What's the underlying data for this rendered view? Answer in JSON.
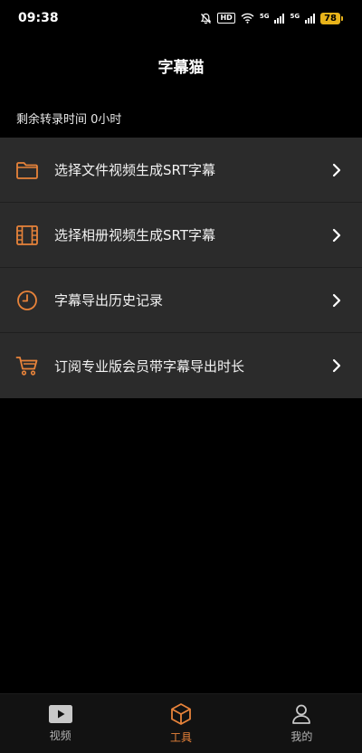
{
  "status_bar": {
    "time": "09:38",
    "hd_label": "HD",
    "net1_label": "5G",
    "net2_label": "5G",
    "battery": "78",
    "icons": [
      "mute-bell-icon",
      "wifi-icon",
      "signal-icon",
      "signal-icon",
      "battery-icon"
    ]
  },
  "header": {
    "title": "字幕猫"
  },
  "remaining": {
    "text": "剩余转录时间 0小时"
  },
  "menu": {
    "items": [
      {
        "label": "选择文件视频生成SRT字幕",
        "icon": "folder-icon"
      },
      {
        "label": "选择相册视频生成SRT字幕",
        "icon": "film-icon"
      },
      {
        "label": "字幕导出历史记录",
        "icon": "clock-icon"
      },
      {
        "label": "订阅专业版会员带字幕导出时长",
        "icon": "cart-icon"
      }
    ]
  },
  "tabbar": {
    "tabs": [
      {
        "label": "视频",
        "icon": "video-play-icon",
        "active": false
      },
      {
        "label": "工具",
        "icon": "box-icon",
        "active": true
      },
      {
        "label": "我的",
        "icon": "person-icon",
        "active": false
      }
    ]
  },
  "colors": {
    "accent": "#e8833a",
    "background": "#000000",
    "menu_bg": "#2b2b2b",
    "battery": "#e8b31a"
  }
}
